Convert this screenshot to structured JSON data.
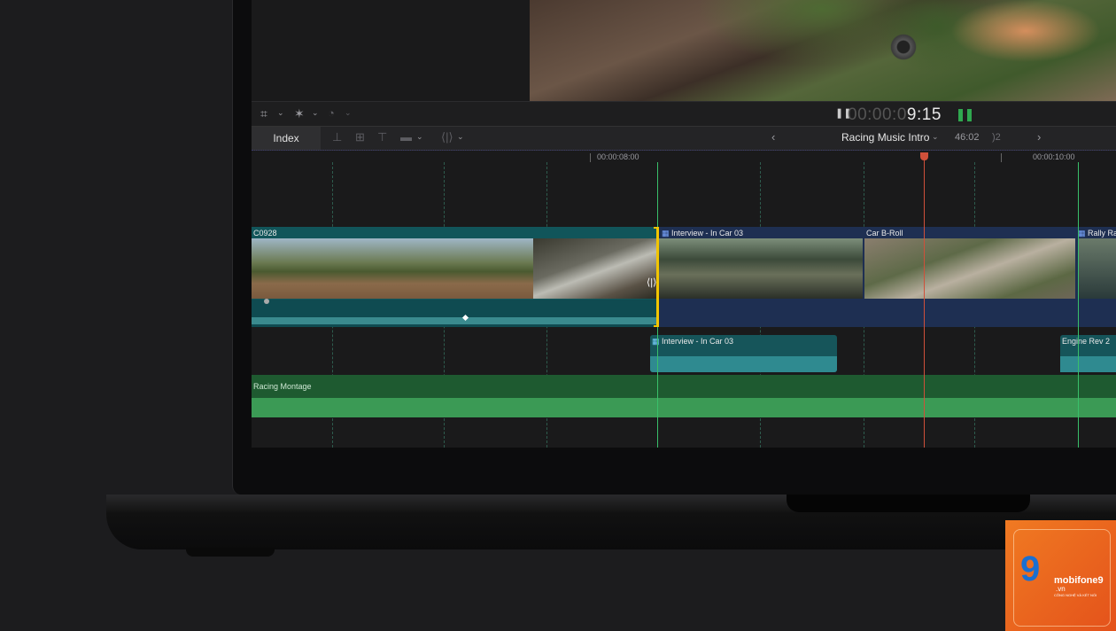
{
  "toolbar": {
    "crop_icon": "crop-icon",
    "enhance_icon": "magic-wand-icon",
    "speed_icon": "speed-icon",
    "timecode_dim": "00:00:0",
    "timecode_bright": "9:15",
    "index_label": "Index",
    "project_name": "Racing Music Intro",
    "project_duration": "46:02",
    "duration_fragment": ")2"
  },
  "ruler": {
    "tc_left": "00:00:08:00",
    "tc_right": "00:00:10:00"
  },
  "clips": {
    "primary_1": "C0928",
    "primary_2": "Interview - In Car 03",
    "primary_3": "Car B-Roll",
    "primary_4": "Rally Ra",
    "connected_1": "Interview - In Car 03",
    "connected_2": "Engine Rev 2",
    "music": "Racing Montage"
  },
  "watermark": {
    "brand": "mobifone9",
    "domain": ".vn",
    "tagline": "CÔNG NGHỆ VÀ KẾT NỐI"
  },
  "colors": {
    "primary_clip": "#11555a",
    "interview_clip": "#1e2f52",
    "music_clip": "#1e5a30",
    "playhead": "#d0503a",
    "trim_edge": "#f2c500"
  }
}
